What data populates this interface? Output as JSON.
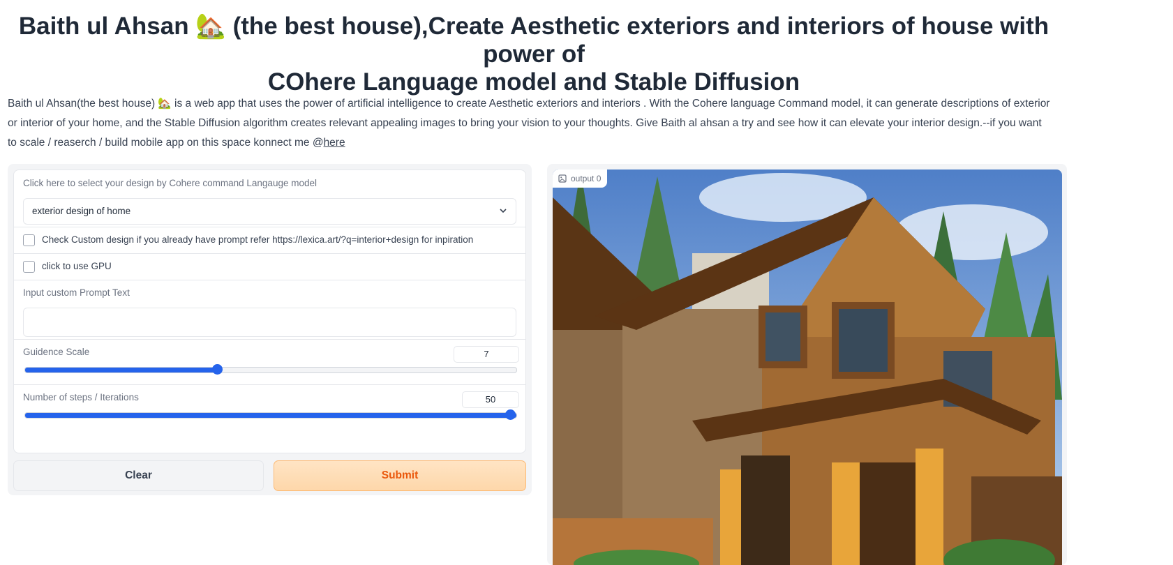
{
  "header": {
    "title_line1": "Baith ul Ahsan 🏡 (the best house),Create Aesthetic exteriors and interiors of house with power of",
    "title_line2": "COhere Language model and Stable Diffusion"
  },
  "description": {
    "text": "Baith ul Ahsan(the best house) 🏡 is a web app that uses the power of artificial intelligence to create Aesthetic exteriors and interiors . With the Cohere language Command model, it can generate descriptions of exterior or interior of your home, and the Stable Diffusion algorithm creates relevant appealing images to bring your vision to your thoughts. Give Baith al ahsan a try and see how it can elevate your interior design.--if you want to scale / reaserch / build mobile app on this space konnect me @",
    "link": "here"
  },
  "form": {
    "design_select": {
      "label": "Click here to select your design by Cohere command Langauge model",
      "value": "exterior design of home"
    },
    "custom_design": {
      "label": "Check Custom design if you already have prompt refer https://lexica.art/?q=interior+design for inpiration",
      "checked": false
    },
    "gpu": {
      "label": "click to use GPU",
      "checked": false
    },
    "prompt": {
      "label": "Input custom Prompt Text",
      "value": ""
    },
    "guidance": {
      "label": "Guidence Scale",
      "value": "7",
      "fraction": 0.39
    },
    "steps": {
      "label": "Number of steps / Iterations",
      "value": "50",
      "fraction": 1.0
    }
  },
  "buttons": {
    "clear": "Clear",
    "submit": "Submit"
  },
  "output": {
    "label": "output 0",
    "image_icon": "image-icon"
  },
  "colors": {
    "accent": "#2563eb",
    "submit_text": "#ea580c",
    "submit_bg": "#fed7aa"
  }
}
